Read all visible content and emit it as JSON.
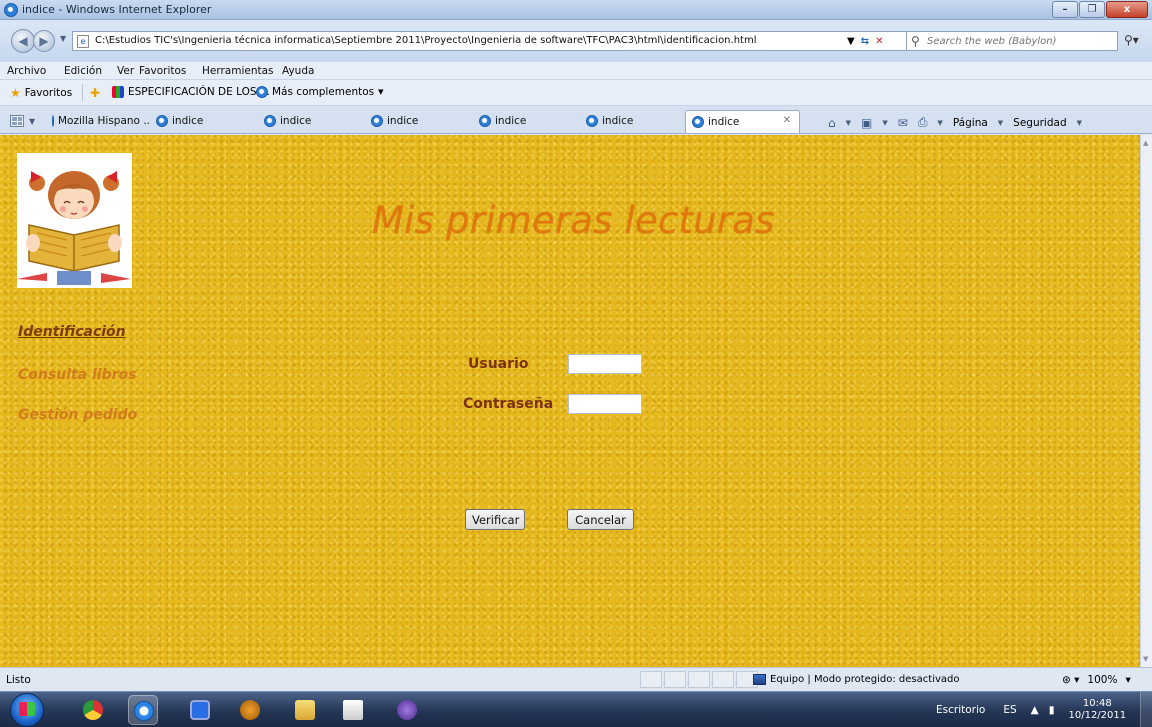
{
  "window": {
    "title": "indice - Windows Internet Explorer",
    "min_label": "–",
    "max_label": "❐",
    "close_label": "x"
  },
  "address_bar": {
    "url": "C:\\Estudios TIC's\\Ingenieria técnica informatica\\Septiembre 2011\\Proyecto\\Ingenieria de software\\TFC\\PAC3\\html\\identificacion.html"
  },
  "search": {
    "placeholder": "Search the web (Babylon)"
  },
  "menu": {
    "items": [
      "Archivo",
      "Edición",
      "Ver",
      "Favoritos",
      "Herramientas",
      "Ayuda"
    ]
  },
  "favorites_bar": {
    "favorites_label": "Favoritos",
    "link1": "ESPECIFICACIÓN DE LOS ...",
    "link2": "Más complementos"
  },
  "tabs": [
    {
      "label": "Mozilla Hispano ..."
    },
    {
      "label": "indice"
    },
    {
      "label": "indice"
    },
    {
      "label": "indice"
    },
    {
      "label": "indice"
    },
    {
      "label": "indice"
    },
    {
      "label": "indice"
    }
  ],
  "command_bar": {
    "page_label": "Página",
    "security_label": "Seguridad"
  },
  "page": {
    "heading": "Mis primeras lecturas",
    "nav": {
      "identificacion": "Identificación",
      "consulta": "Consulta libros",
      "gestion": "Gestión pedido"
    },
    "form": {
      "user_label": "Usuario",
      "user_value": "",
      "password_label": "Contraseña",
      "password_value": "",
      "verify_button": "Verificar",
      "cancel_button": "Cancelar"
    }
  },
  "status_bar": {
    "status": "Listo",
    "zone": "Equipo | Modo protegido: desactivado",
    "zoom": "100%"
  },
  "taskbar": {
    "desktop_label": "Escritorio",
    "language": "ES",
    "time": "10:48",
    "date": "10/12/2011"
  }
}
